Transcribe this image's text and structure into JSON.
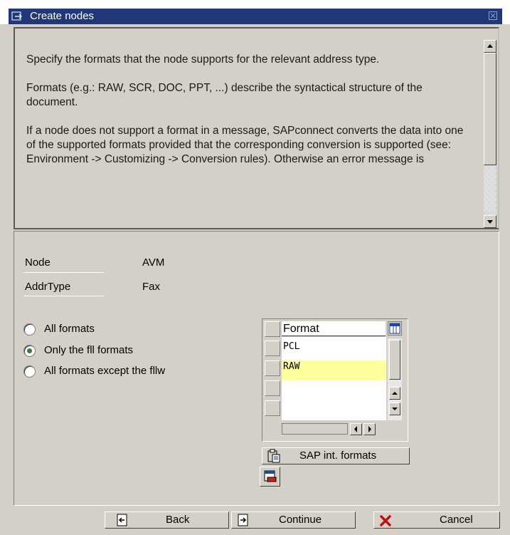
{
  "window": {
    "title": "Create nodes"
  },
  "help": {
    "paragraphs": [
      "Specify the formats that the node supports for the relevant address type.",
      "Formats (e.g.: RAW, SCR, DOC, PPT, ...) describe the syntactical structure of the document.",
      "If a node does not support a format in a message, SAPconnect converts the data into one of the supported formats provided that the corresponding conversion is supported (see: Environment -> Customizing -> Conversion rules). Otherwise an error message is"
    ]
  },
  "fields": {
    "node_label": "Node",
    "node_value": "AVM",
    "addrtype_label": "AddrType",
    "addrtype_value": "Fax"
  },
  "format_options": {
    "options": [
      {
        "label": "All formats",
        "selected": false
      },
      {
        "label": "Only the fll formats",
        "selected": true
      },
      {
        "label": "All formats except the fllw",
        "selected": false
      }
    ]
  },
  "format_table": {
    "column_header": "Format",
    "rows": [
      {
        "value": "PCL",
        "highlighted": false
      },
      {
        "value": "RAW",
        "highlighted": true
      }
    ],
    "highlight_color": "#ffff9c"
  },
  "buttons": {
    "sap_formats": "SAP int. formats",
    "back": "Back",
    "continue": "Continue",
    "cancel": "Cancel"
  },
  "colors": {
    "titlebar": "#20387a",
    "background": "#d4d0c8"
  },
  "icons": {
    "title": "window-icon",
    "close": "close-icon",
    "table_settings": "table-settings-icon",
    "sap_formats": "clipboard-icon",
    "small_button": "delete-row-icon",
    "back": "back-icon",
    "continue": "continue-icon",
    "cancel": "cancel-x-icon"
  }
}
